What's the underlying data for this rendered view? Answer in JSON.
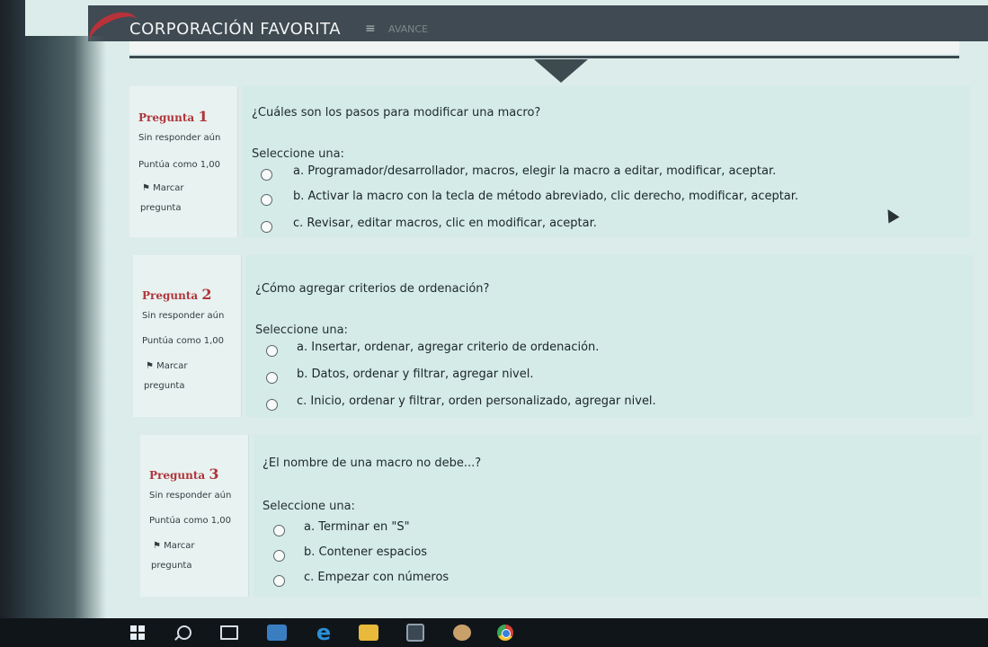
{
  "app": {
    "brand": "CORPORACIÓN FAVORITA",
    "nav_icon": "≡",
    "nav_faint": "AVANCE"
  },
  "quiz": {
    "select_label": "Seleccione una:",
    "questions": [
      {
        "label": "Pregunta",
        "number": "1",
        "status": "Sin responder aún",
        "score": "Puntúa como 1,00",
        "flag_line1": "Marcar",
        "flag_line2": "pregunta",
        "text": "¿Cuáles son los pasos para modificar una macro?",
        "options": [
          "a. Programador/desarrollador, macros, elegir la macro a editar, modificar, aceptar.",
          "b. Activar la macro con la tecla de método abreviado, clic derecho, modificar, aceptar.",
          "c. Revisar, editar macros, clic en modificar, aceptar."
        ]
      },
      {
        "label": "Pregunta",
        "number": "2",
        "status": "Sin responder aún",
        "score": "Puntúa como 1,00",
        "flag_line1": "Marcar",
        "flag_line2": "pregunta",
        "text": "¿Cómo agregar criterios de ordenación?",
        "options": [
          "a. Insertar, ordenar, agregar criterio de ordenación.",
          "b. Datos, ordenar y filtrar, agregar nivel.",
          "c. Inicio, ordenar y filtrar, orden personalizado, agregar nivel."
        ]
      },
      {
        "label": "Pregunta",
        "number": "3",
        "status": "Sin responder aún",
        "score": "Puntúa como 1,00",
        "flag_line1": "Marcar",
        "flag_line2": "pregunta",
        "text": "¿El nombre de una macro no debe...?",
        "options": [
          "a. Terminar en \"S\"",
          "b. Contener espacios",
          "c. Empezar con números"
        ]
      }
    ]
  },
  "taskbar": {
    "icons": [
      "windows-start-icon",
      "search-icon",
      "task-view-icon",
      "store-icon",
      "edge-icon",
      "file-explorer-icon",
      "calculator-icon",
      "paint-icon",
      "chrome-icon"
    ]
  },
  "colors": {
    "accent": "#b0353a",
    "header": "#3f4a52",
    "question_bg": "#d4ebe8"
  }
}
